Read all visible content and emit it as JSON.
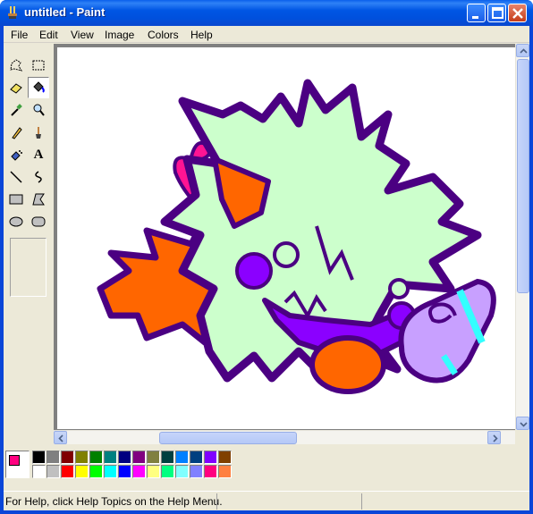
{
  "window": {
    "title": "untitled - Paint",
    "title_color": "#ffffff",
    "titlebar_color": "#0054e3"
  },
  "menu": {
    "items": [
      {
        "label": "File"
      },
      {
        "label": "Edit"
      },
      {
        "label": "View"
      },
      {
        "label": "Image"
      },
      {
        "label": "Colors"
      },
      {
        "label": "Help"
      }
    ]
  },
  "toolbox": {
    "tools": [
      {
        "name": "free-form-select-icon"
      },
      {
        "name": "select-icon"
      },
      {
        "name": "eraser-icon"
      },
      {
        "name": "fill-with-color-icon",
        "active": true
      },
      {
        "name": "pick-color-icon"
      },
      {
        "name": "magnifier-icon"
      },
      {
        "name": "pencil-icon"
      },
      {
        "name": "brush-icon"
      },
      {
        "name": "airbrush-icon"
      },
      {
        "name": "text-icon",
        "glyph": "A"
      },
      {
        "name": "line-icon"
      },
      {
        "name": "curve-icon"
      },
      {
        "name": "rectangle-icon"
      },
      {
        "name": "polygon-icon"
      },
      {
        "name": "ellipse-icon"
      },
      {
        "name": "rounded-rectangle-icon"
      }
    ]
  },
  "canvas": {
    "drawing_colors": {
      "outline": "#4b0082",
      "body": "#ccffcc",
      "orange": "#ff6600",
      "pink": "#ff1493",
      "purple": "#8b00ff",
      "lavender": "#c8a0ff",
      "cyan": "#33ffff"
    }
  },
  "palette": {
    "foreground": "#ff0080",
    "background": "#00ffff",
    "colors_top": [
      "#000000",
      "#808080",
      "#800000",
      "#808000",
      "#008000",
      "#008080",
      "#000080",
      "#800080",
      "#808040",
      "#004040",
      "#0080ff",
      "#004080",
      "#8000ff",
      "#804000"
    ],
    "colors_bottom": [
      "#ffffff",
      "#c0c0c0",
      "#ff0000",
      "#ffff00",
      "#00ff00",
      "#00ffff",
      "#0000ff",
      "#ff00ff",
      "#ffff80",
      "#00ff80",
      "#80ffff",
      "#8080ff",
      "#ff0080",
      "#ff8040"
    ]
  },
  "statusbar": {
    "text": "For Help, click Help Topics on the Help Menu."
  }
}
